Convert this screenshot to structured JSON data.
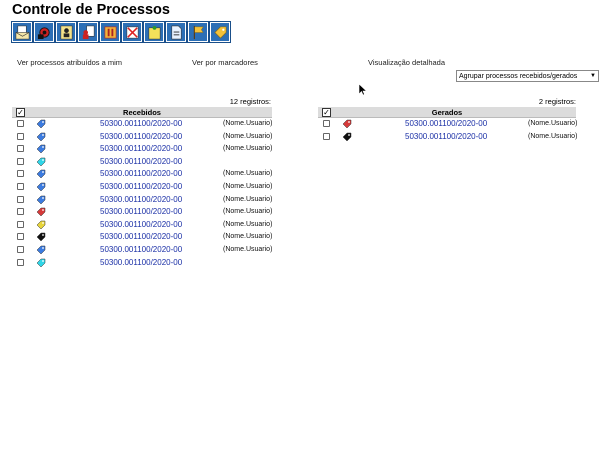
{
  "page": {
    "title": "Controle de Processos"
  },
  "toolbar": {
    "buttons": [
      {
        "icon": "envelope-document-icon"
      },
      {
        "icon": "gear-process-icon"
      },
      {
        "icon": "person-assign-icon"
      },
      {
        "icon": "user-documents-icon"
      },
      {
        "icon": "pause-icon"
      },
      {
        "icon": "document-cancel-icon"
      },
      {
        "icon": "note-pin-icon"
      },
      {
        "icon": "new-document-icon"
      },
      {
        "icon": "flag-icon"
      },
      {
        "icon": "tag-icon"
      }
    ]
  },
  "links": {
    "atribuidos": "Ver processos atribuídos a mim",
    "marcadores": "Ver por marcadores",
    "detalhada": "Visualização detalhada"
  },
  "group_select": {
    "value": "Agrupar processos recebidos/gerados"
  },
  "recebidos": {
    "count": "12 registros:",
    "header": "Recebidos",
    "header_check": "✓",
    "rows": [
      {
        "icon": "tag-blue",
        "process": "50300.001100/2020-00",
        "user": "(Nome.Usuario)"
      },
      {
        "icon": "tag-blue",
        "process": "50300.001100/2020-00",
        "user": "(Nome.Usuario)"
      },
      {
        "icon": "tag-blue",
        "process": "50300.001100/2020-00",
        "user": "(Nome.Usuario)"
      },
      {
        "icon": "tag-cyan",
        "process": "50300.001100/2020-00",
        "user": ""
      },
      {
        "icon": "tag-blue",
        "process": "50300.001100/2020-00",
        "user": "(Nome.Usuario)"
      },
      {
        "icon": "tag-blue",
        "process": "50300.001100/2020-00",
        "user": "(Nome.Usuario)"
      },
      {
        "icon": "tag-blue",
        "process": "50300.001100/2020-00",
        "user": "(Nome.Usuario)"
      },
      {
        "icon": "tag-red",
        "process": "50300.001100/2020-00",
        "user": "(Nome.Usuario)"
      },
      {
        "icon": "tag-yellow",
        "process": "50300.001100/2020-00",
        "user": "(Nome.Usuario)"
      },
      {
        "icon": "tag-black",
        "process": "50300.001100/2020-00",
        "user": "(Nome.Usuario)"
      },
      {
        "icon": "tag-blue",
        "process": "50300.001100/2020-00",
        "user": "(Nome.Usuario)"
      },
      {
        "icon": "tag-cyan",
        "process": "50300.001100/2020-00",
        "user": ""
      }
    ]
  },
  "gerados": {
    "count": "2 registros:",
    "header": "Gerados",
    "header_check": "✓",
    "rows": [
      {
        "icon": "tag-red",
        "process": "50300.001100/2020-00",
        "user": "(Nome.Usuario)"
      },
      {
        "icon": "tag-black",
        "process": "50300.001100/2020-00",
        "user": "(Nome.Usuario)"
      }
    ]
  },
  "colors": {
    "link": "#1a2fa6",
    "toolbar_bg": "#2c6fb6",
    "header_bg": "#dcdcdc",
    "tag-blue": "#3b7be0",
    "tag-cyan": "#2fd6e8",
    "tag-red": "#d63a3a",
    "tag-yellow": "#e8d53a",
    "tag-black": "#111111"
  }
}
